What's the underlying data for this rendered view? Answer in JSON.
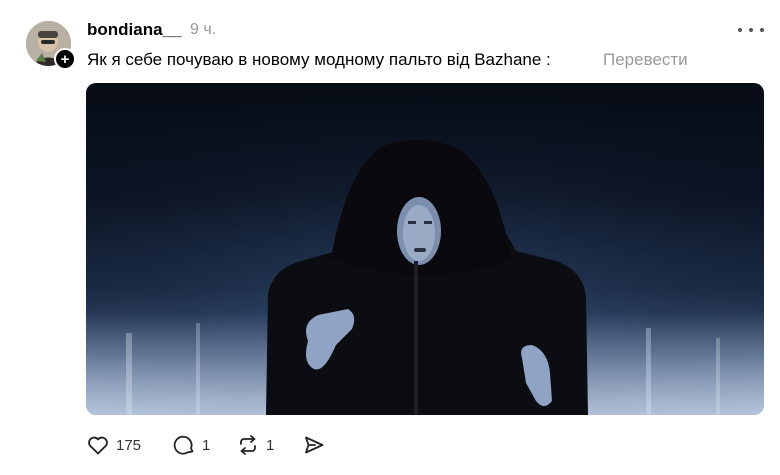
{
  "post": {
    "username": "bondiana__",
    "time": "9 ч.",
    "caption": "Як я себе почуваю в новому модному пальто від Bazhane :",
    "translate_label": "Перевести",
    "follow_symbol": "+"
  },
  "actions": {
    "likes": "175",
    "replies": "1",
    "reposts": "1"
  },
  "icons": [
    "avatar",
    "plus-icon",
    "more-icon",
    "heart-icon",
    "comment-icon",
    "repost-icon",
    "share-icon"
  ]
}
